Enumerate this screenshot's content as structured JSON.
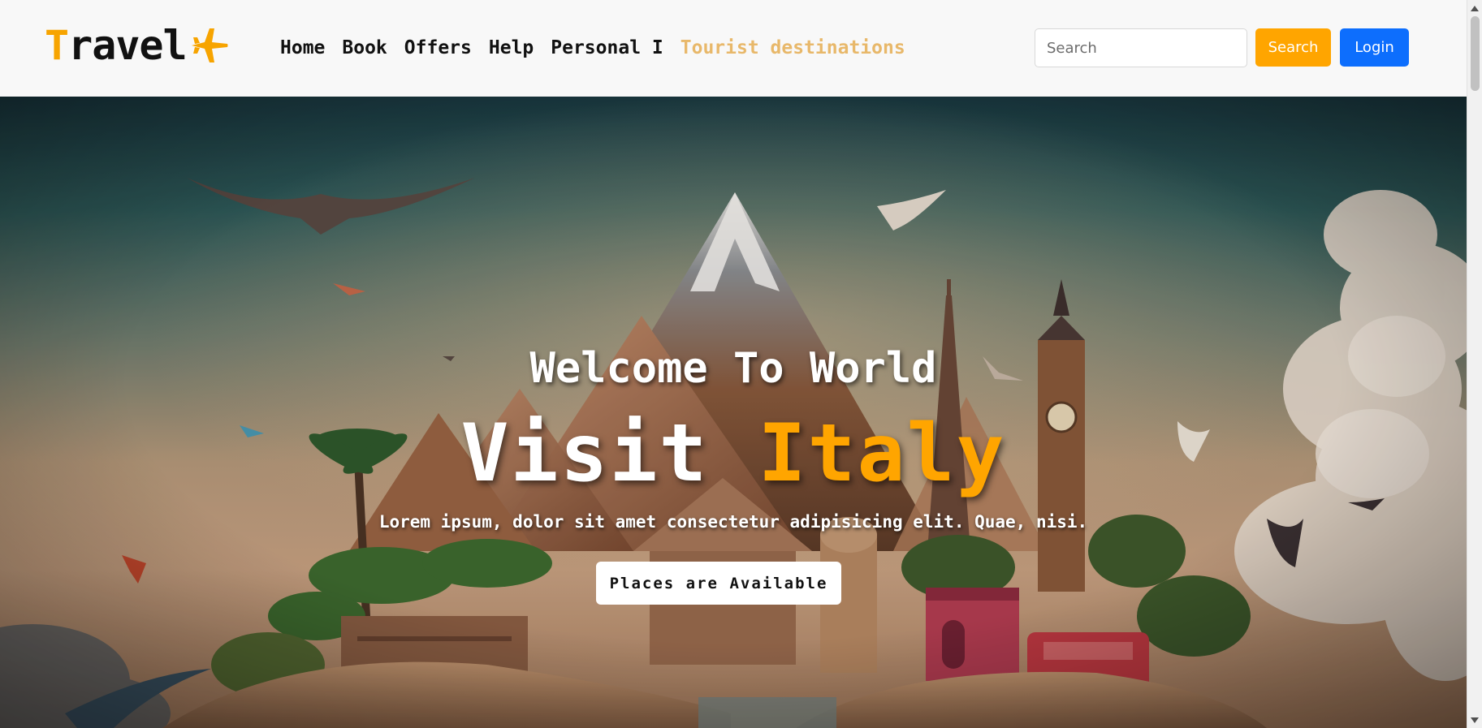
{
  "brand": {
    "first_letter": "T",
    "rest": "ravel",
    "icon": "airplane-icon"
  },
  "nav": {
    "items": [
      {
        "label": "Home"
      },
      {
        "label": "Book"
      },
      {
        "label": "Offers"
      },
      {
        "label": "Help"
      },
      {
        "label": "Personal I"
      },
      {
        "label": "Tourist destinations",
        "active": true
      }
    ]
  },
  "search": {
    "placeholder": "Search",
    "value": "",
    "button_label": "Search"
  },
  "login": {
    "label": "Login"
  },
  "hero": {
    "subtitle": "Welcome To World",
    "title_part1": "Visit ",
    "title_part2": "Italy",
    "text": "Lorem ipsum, dolor sit amet consectetur adipisicing elit. Quae, nisi.",
    "button_label": "Places are Available"
  },
  "colors": {
    "accent": "#ffa500",
    "login": "#0d6efd",
    "active_nav": "#e8b86a",
    "navbar_bg": "#f8f8f8"
  }
}
